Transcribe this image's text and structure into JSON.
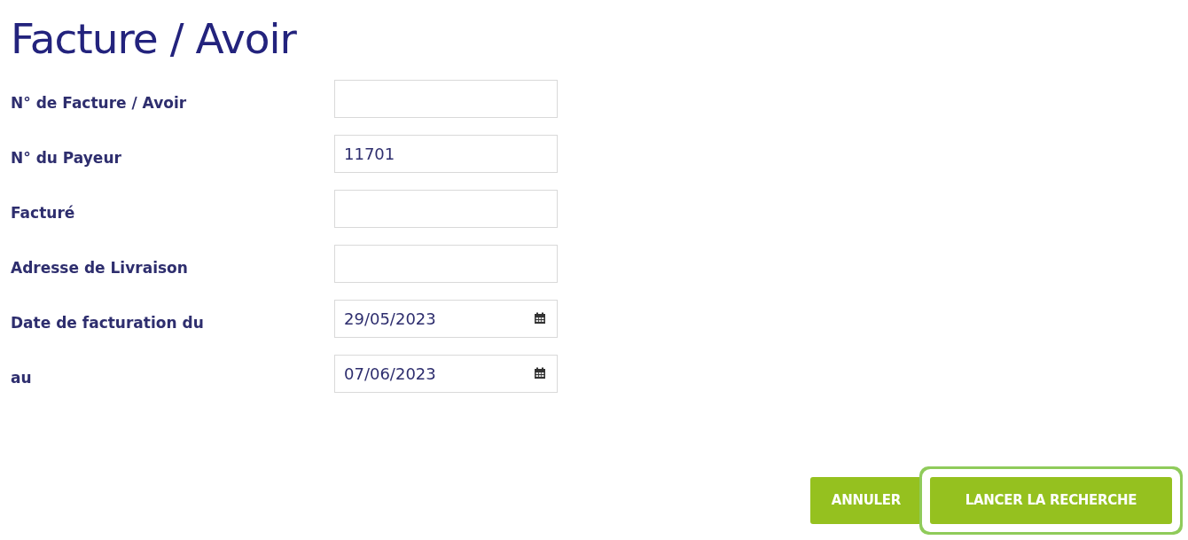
{
  "title": "Facture / Avoir",
  "fields": [
    {
      "label": "N° de Facture / Avoir",
      "kind": "text"
    },
    {
      "label": "N° du Payeur",
      "kind": "text",
      "value": "11701"
    },
    {
      "label": "Facturé",
      "kind": "text"
    },
    {
      "label": "Adresse de Livraison",
      "kind": "text"
    },
    {
      "label": "Date de facturation du",
      "kind": "date",
      "value": "29/05/2023"
    },
    {
      "label": "au",
      "kind": "date",
      "value": "07/06/2023"
    }
  ],
  "buttons": [
    {
      "label": "ANNULER",
      "focused": false
    },
    {
      "label": "LANCER LA RECHERCHE",
      "focused": true
    }
  ]
}
